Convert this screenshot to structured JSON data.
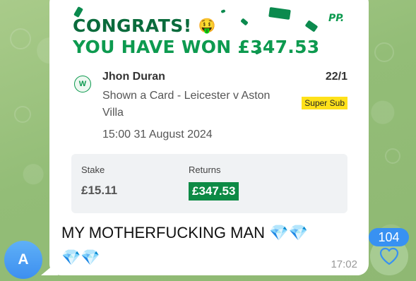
{
  "slip": {
    "headline": "CONGRATS!",
    "headline_emoji": "🤑",
    "won_text": "YOU HAVE WON £347.53",
    "brand_logo": "PP.",
    "selection_badge": "W",
    "player": "Jhon Duran",
    "odds": "22/1",
    "market": "Shown a Card - Leicester v Aston Villa",
    "tag": "Super Sub",
    "datetime": "15:00 31 August 2024",
    "stake_label": "Stake",
    "stake_value": "£15.11",
    "returns_label": "Returns",
    "returns_value": "£347.53"
  },
  "message": {
    "text": "MY MOTHERFUCKING MAN",
    "gems_line1": "💎💎",
    "gems_line2": "💎💎",
    "time": "17:02"
  },
  "sender": {
    "avatar_letter": "A"
  },
  "reaction": {
    "count": "104",
    "icon": "heart-icon"
  },
  "colors": {
    "brand_dark_green": "#0a6b3c",
    "brand_green": "#0d9a4f",
    "tag_yellow": "#ffe11a",
    "reaction_blue": "#3891f2"
  }
}
